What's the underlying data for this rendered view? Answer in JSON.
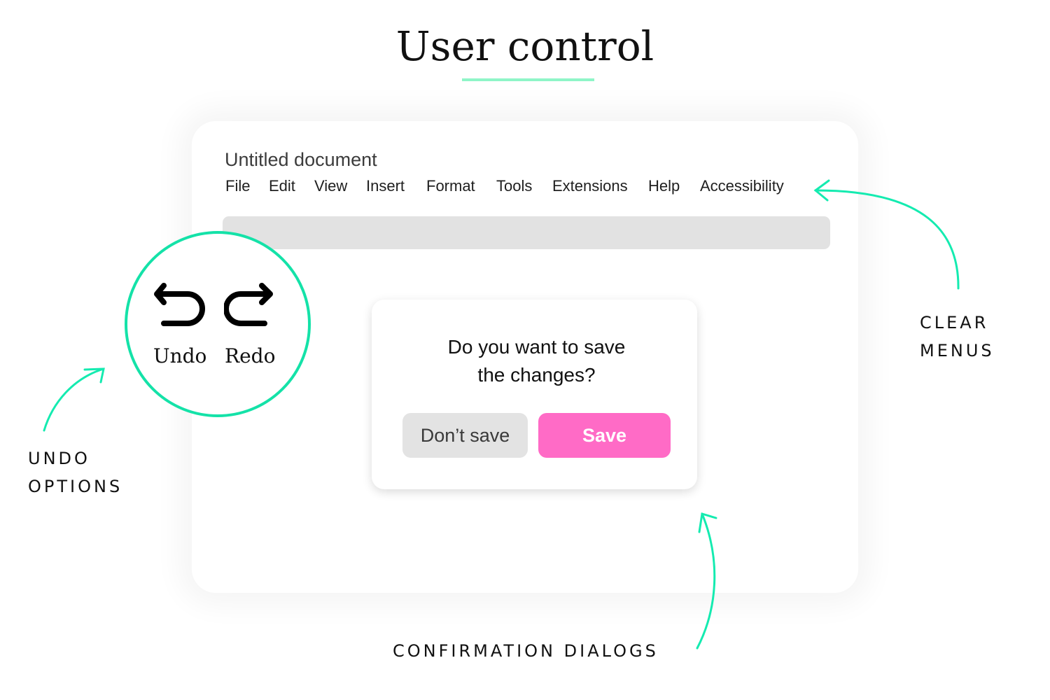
{
  "header": {
    "title": "User control",
    "accent_color": "#8ff5c8"
  },
  "document": {
    "title": "Untitled document",
    "menu": [
      "File",
      "Edit",
      "View",
      "Insert",
      "Format",
      "Tools",
      "Extensions",
      "Help",
      "Accessibility"
    ]
  },
  "undo_redo": {
    "undo_label": "Undo",
    "redo_label": "Redo",
    "undo_icon": "undo-icon",
    "redo_icon": "redo-icon",
    "highlight_color": "#14e2a8"
  },
  "dialog": {
    "message_line1": "Do you want to save",
    "message_line2": "the changes?",
    "dont_save_label": "Don’t save",
    "save_label": "Save",
    "save_color": "#ff6bc6"
  },
  "annotations": {
    "clear_menus_line1": "CLEAR",
    "clear_menus_line2": "MENUS",
    "undo_options_line1": "UNDO",
    "undo_options_line2": "OPTIONS",
    "confirmation_dialogs": "CONFIRMATION DIALOGS",
    "arrow_color": "#14ebb0"
  }
}
